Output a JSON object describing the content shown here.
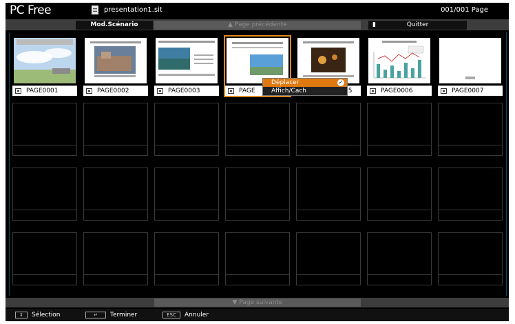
{
  "app_title": "PC Free",
  "file_name": "presentation1.sit",
  "page_count": "001/001 Page",
  "toolbar": {
    "mode_label": "Mod.Scénario",
    "prev_label": "▲ Page précédente",
    "quit_label": "Quitter"
  },
  "thumbnails": [
    {
      "label": "PAGE0001"
    },
    {
      "label": "PAGE0002"
    },
    {
      "label": "PAGE0003"
    },
    {
      "label": "PAGE"
    },
    {
      "label": "05"
    },
    {
      "label": "PAGE0006"
    },
    {
      "label": "PAGE0007"
    }
  ],
  "context_menu": {
    "items": [
      "Déplacer",
      "Affich/Cach"
    ]
  },
  "next_label": "▼ Page suivante",
  "status": {
    "select_key": "⇕",
    "select_label": "Sélection",
    "enter_key": "↵",
    "enter_label": "Terminer",
    "esc_key": "ESC",
    "esc_label": "Annuler"
  },
  "colors": {
    "accent": "#e07a10",
    "background": "#000000",
    "toolbar": "#3d3d3d"
  }
}
